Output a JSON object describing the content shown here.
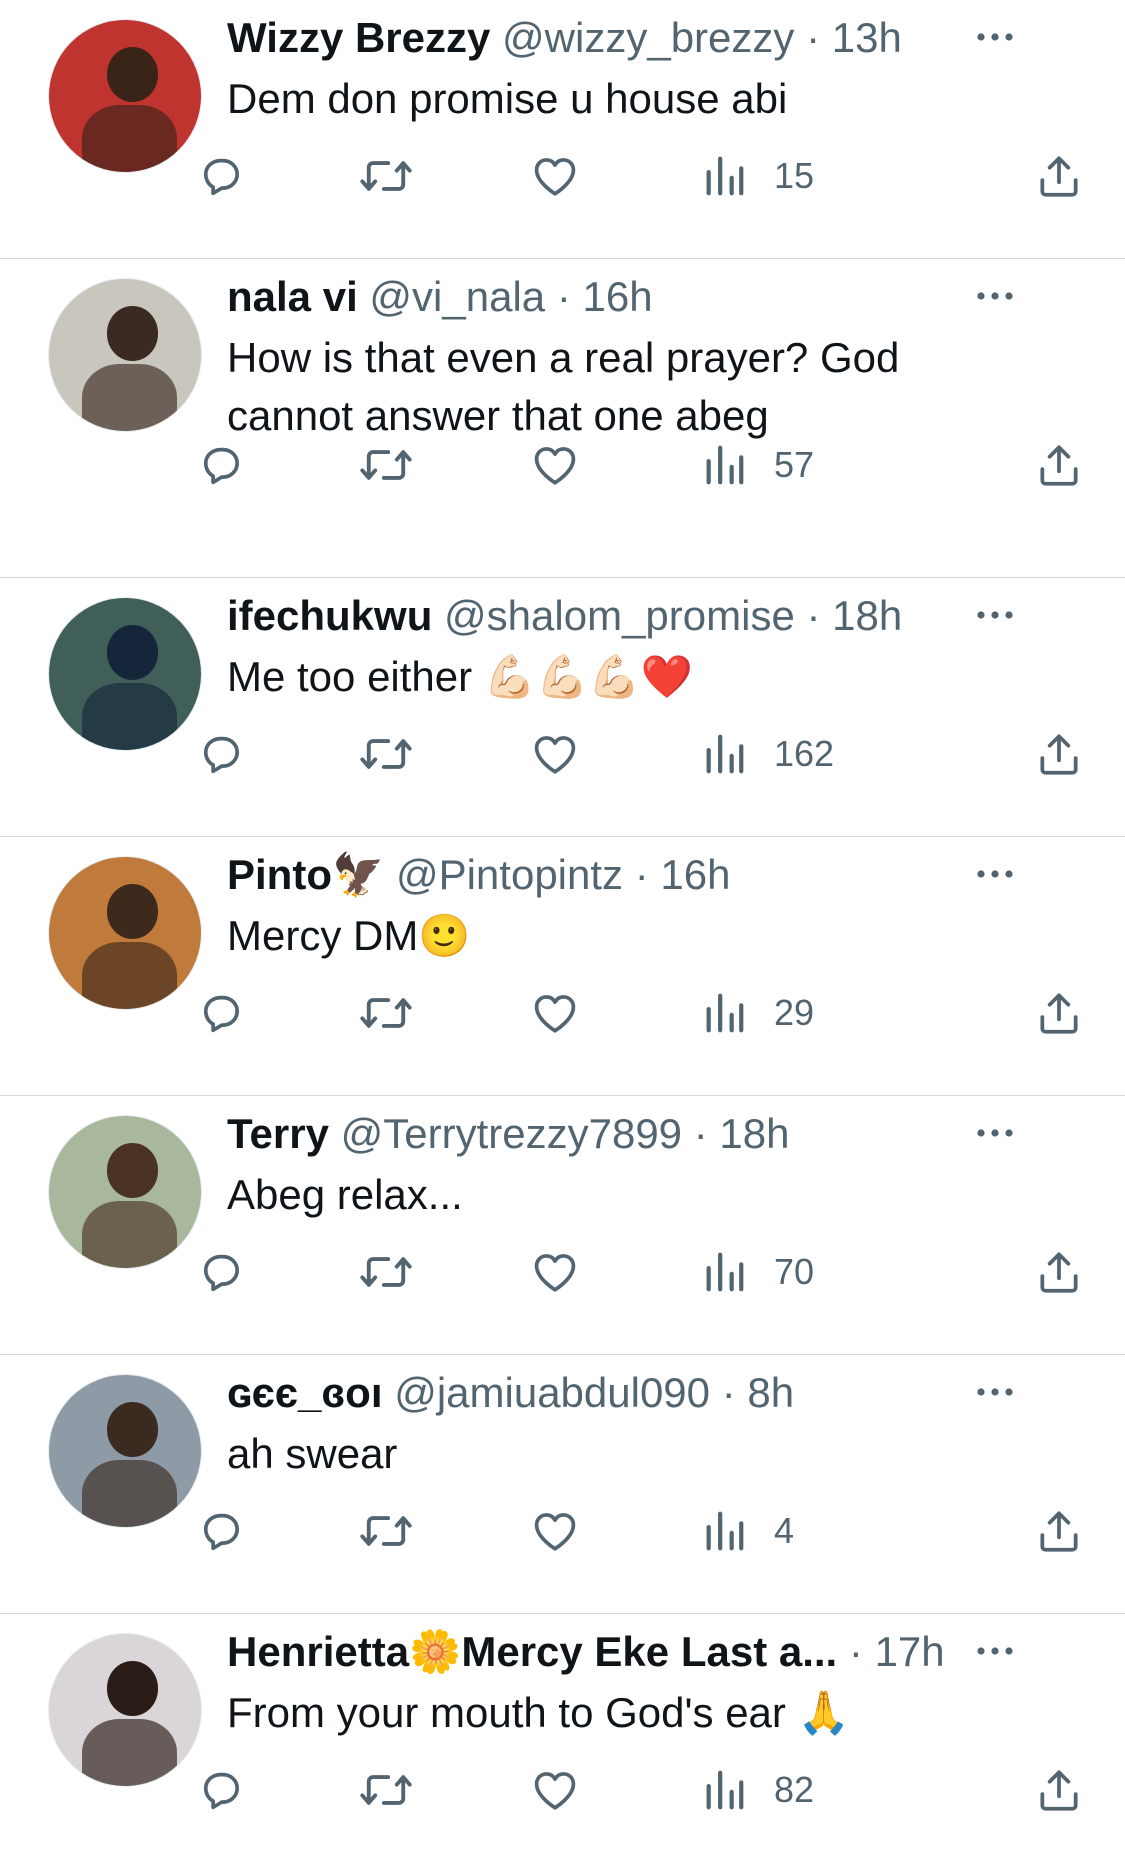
{
  "tweets": [
    {
      "name": "Wizzy Brezzy",
      "handle": "@wizzy_brezzy",
      "dot": "·",
      "time": "13h",
      "text": "Dem don promise u house abi",
      "views": "15",
      "avatar_bg": "#c0342f",
      "avatar_face": "#3a2418"
    },
    {
      "name": "nala vi",
      "handle": "@vi_nala",
      "dot": "·",
      "time": "16h",
      "text": "How is that even a real prayer? God cannot answer that one abeg",
      "views": "57",
      "avatar_bg": "#c9c6bd",
      "avatar_face": "#3b2a22"
    },
    {
      "name": "ifechukwu",
      "handle": "@shalom_promise",
      "dot": "·",
      "time": "18h",
      "text": "Me too either 💪🏻💪🏻💪🏻❤️",
      "views": "162",
      "avatar_bg": "#3f5f58",
      "avatar_face": "#15263a"
    },
    {
      "name": "Pinto🦅",
      "handle": "@Pintopintz",
      "dot": "·",
      "time": "16h",
      "text": "Mercy DM🙂",
      "views": "29",
      "avatar_bg": "#c07a3b",
      "avatar_face": "#3d2a1c"
    },
    {
      "name": "Terry",
      "handle": "@Terrytrezzy7899",
      "dot": "·",
      "time": "18h",
      "text": "Abeg relax...",
      "views": "70",
      "avatar_bg": "#a9b79c",
      "avatar_face": "#4a3324"
    },
    {
      "name": "ɢєє_ɞoı",
      "handle": "@jamiuabdul090",
      "dot": "·",
      "time": "8h",
      "text": "ah swear",
      "views": "4",
      "avatar_bg": "#8e9aa6",
      "avatar_face": "#3a2a20"
    },
    {
      "name": "Henrietta🌼Mercy Eke Last a...",
      "handle": "",
      "dot": "·",
      "time": "17h",
      "text": "From your mouth to God's ear 🙏",
      "views": "82",
      "avatar_bg": "#d9d5d8",
      "avatar_face": "#2a1c16"
    }
  ],
  "icons": {
    "reply": "reply-icon",
    "retweet": "retweet-icon",
    "like": "heart-icon",
    "views": "views-icon",
    "share": "share-icon",
    "more": "more-icon"
  },
  "colors": {
    "text": "#0f1419",
    "secondary": "#536471",
    "divider": "#cfd9de"
  }
}
